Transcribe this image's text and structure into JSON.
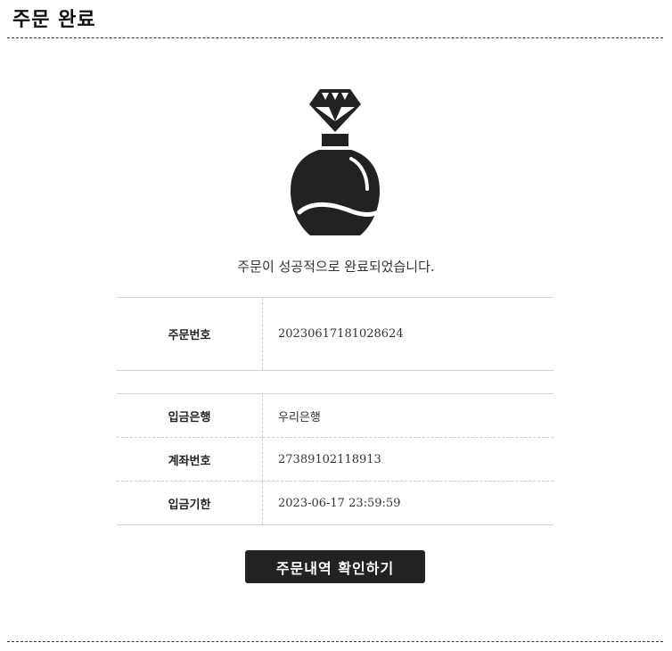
{
  "header": {
    "title": "주문 완료"
  },
  "hero": {
    "icon": "perfume-bottle-icon",
    "message": "주문이 성공적으로 완료되었습니다."
  },
  "order": {
    "number_label": "주문번호",
    "number_value": "20230617181028624"
  },
  "payment": {
    "rows": [
      {
        "label": "입금은행",
        "value": "우리은행"
      },
      {
        "label": "계좌번호",
        "value": "27389102118913"
      },
      {
        "label": "입금기한",
        "value": "2023-06-17 23:59:59"
      }
    ]
  },
  "actions": {
    "confirm_label": "주문내역 확인하기"
  },
  "colors": {
    "primary": "#222222",
    "border": "#d4d4d4",
    "dashed_border": "#cccccc",
    "background": "#ffffff"
  }
}
